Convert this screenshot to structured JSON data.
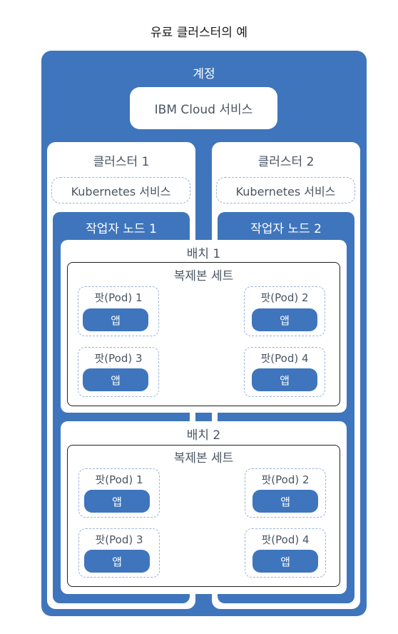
{
  "diagram": {
    "title": "유료 클러스터의 예",
    "account": {
      "label": "계정",
      "service_label": "IBM Cloud 서비스"
    },
    "clusters": [
      {
        "label": "클러스터 1",
        "service_label": "Kubernetes 서비스",
        "worker_node_label": "작업자 노드 1"
      },
      {
        "label": "클러스터 2",
        "service_label": "Kubernetes 서비스",
        "worker_node_label": "작업자 노드 2"
      }
    ],
    "deployments": [
      {
        "label": "배치 1",
        "replicaset_label": "복제본 세트",
        "pods": [
          {
            "label": "팟(Pod) 1",
            "app_label": "앱"
          },
          {
            "label": "팟(Pod) 2",
            "app_label": "앱"
          },
          {
            "label": "팟(Pod) 3",
            "app_label": "앱"
          },
          {
            "label": "팟(Pod) 4",
            "app_label": "앱"
          }
        ]
      },
      {
        "label": "배치 2",
        "replicaset_label": "복제본 세트",
        "pods": [
          {
            "label": "팟(Pod) 1",
            "app_label": "앱"
          },
          {
            "label": "팟(Pod) 2",
            "app_label": "앱"
          },
          {
            "label": "팟(Pod) 3",
            "app_label": "앱"
          },
          {
            "label": "팟(Pod) 4",
            "app_label": "앱"
          }
        ]
      }
    ],
    "colors": {
      "account_blue": "#3f75bc",
      "dashed_border": "#9ab3d6",
      "label_gray": "#4a5563"
    }
  }
}
